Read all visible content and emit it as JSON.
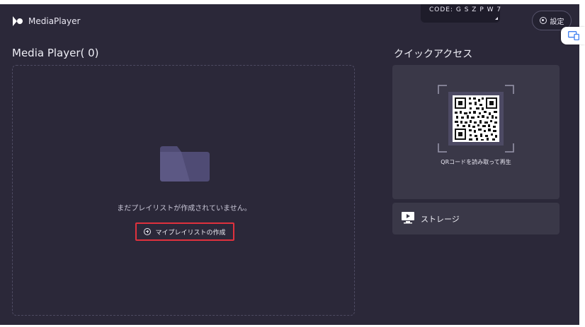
{
  "code_tab": {
    "label": "CODE: G S Z P W 7"
  },
  "header": {
    "app_name": "MediaPlayer",
    "settings_label": "設定"
  },
  "left_panel": {
    "title": "Media Player( 0)",
    "empty_message": "まだプレイリストが作成されていません。",
    "create_button_label": "マイプレイリストの作成"
  },
  "right_panel": {
    "title": "クイックアクセス",
    "qr_caption": "QRコードを読み取って再生",
    "storage_label": "ストレージ"
  },
  "colors": {
    "background": "#2b2839",
    "card": "#3a3848",
    "highlight_border": "#e0313d",
    "side_tab_icon": "#3d7ef0"
  },
  "icons": [
    "logo-icon",
    "settings-icon",
    "folder-icon",
    "plus-circle-icon",
    "qr-code-icon",
    "storage-icon",
    "device-switch-icon"
  ]
}
